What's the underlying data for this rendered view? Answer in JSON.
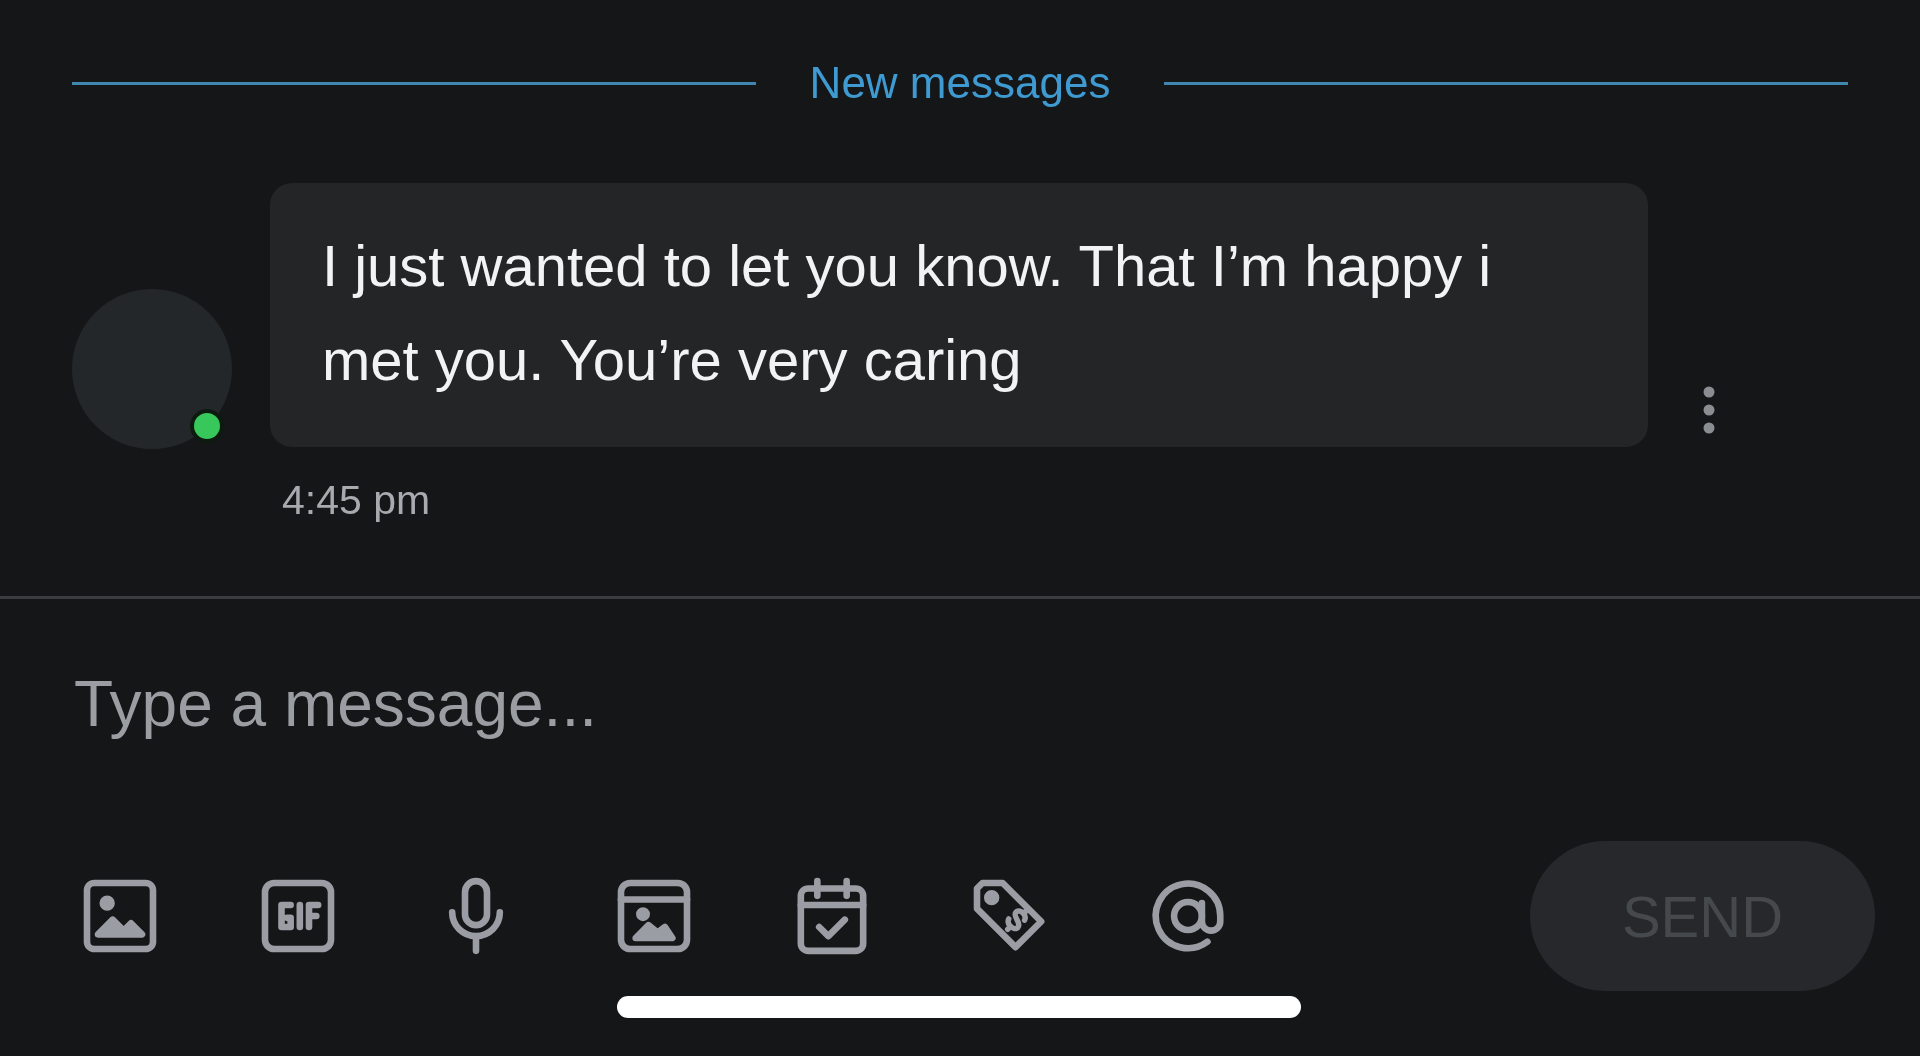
{
  "divider": {
    "label": "New messages"
  },
  "messages": [
    {
      "text": "I just wanted to let you know. That I’m happy i met you. You’re very caring",
      "time": "4:45 pm",
      "online": true
    }
  ],
  "composer": {
    "placeholder": "Type a message...",
    "tools": [
      {
        "kind": "image"
      },
      {
        "kind": "gif"
      },
      {
        "kind": "mic"
      },
      {
        "kind": "gallery"
      },
      {
        "kind": "calendar"
      },
      {
        "kind": "price"
      },
      {
        "kind": "mention"
      }
    ],
    "send": {
      "label": "SEND",
      "disabled": true
    }
  }
}
